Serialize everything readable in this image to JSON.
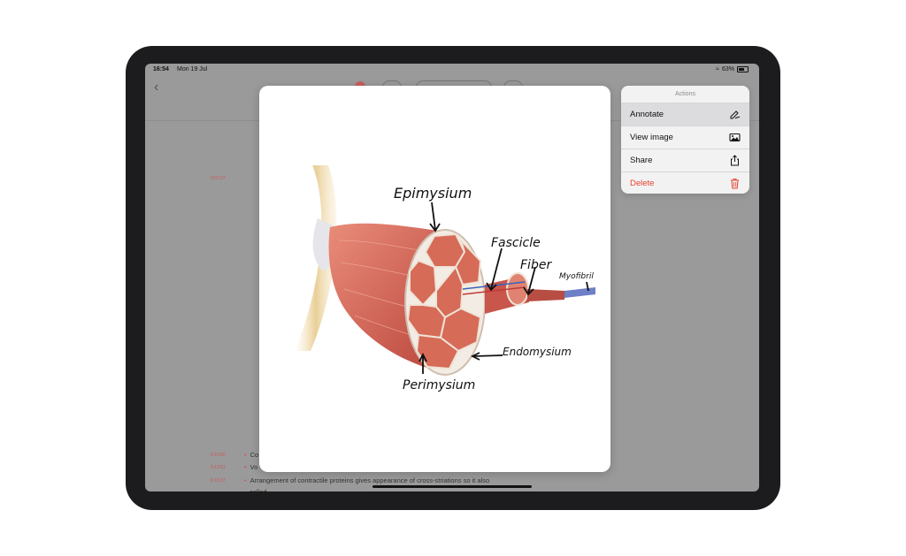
{
  "status_bar": {
    "time": "16:54",
    "date": "Mon 19 Jul",
    "battery": "63%"
  },
  "notes": {
    "top_timestamp": "0:07:27",
    "lines": [
      {
        "timestamp": "0:10:50",
        "text": "Co"
      },
      {
        "timestamp": "0:12:51",
        "text": "Vo"
      },
      {
        "timestamp": "0:15:07",
        "text": "Arrangement of contractile proteins gives appearance of cross-striations so it also"
      },
      {
        "timestamp": "",
        "text": "called"
      }
    ]
  },
  "image": {
    "labels": {
      "epimysium": "Epimysium",
      "fascicle": "Fascicle",
      "fiber": "Fiber",
      "myofibril": "Myofibril",
      "endomysium": "Endomysium",
      "perimysium": "Perimysium"
    }
  },
  "actions_menu": {
    "header": "Actions",
    "items": [
      {
        "label": "Annotate",
        "icon": "annotate-icon"
      },
      {
        "label": "View image",
        "icon": "image-icon"
      },
      {
        "label": "Share",
        "icon": "share-icon"
      },
      {
        "label": "Delete",
        "icon": "trash-icon"
      }
    ],
    "colors": {
      "destructive": "#e5432f",
      "highlight": "#dcdcde"
    }
  }
}
